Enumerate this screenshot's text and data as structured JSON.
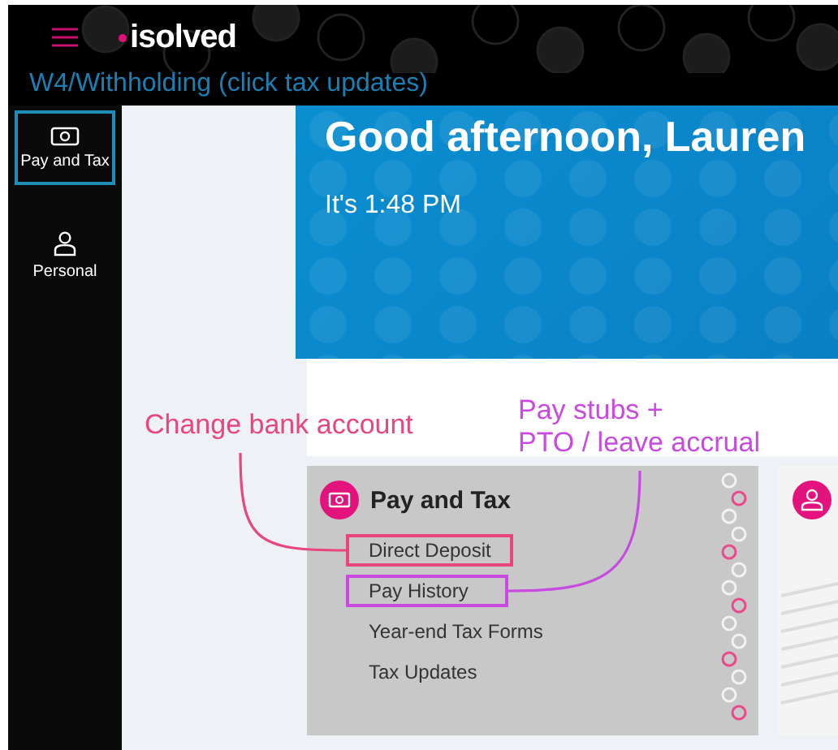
{
  "header": {
    "logo": "isolved",
    "note": "W4/Withholding (click tax updates)"
  },
  "sidebar": {
    "items": [
      {
        "kind": "pay",
        "label": "Pay and Tax",
        "selected": true
      },
      {
        "kind": "person",
        "label": "Personal",
        "selected": false
      }
    ]
  },
  "hero": {
    "greeting": "Good afternoon, Lauren",
    "time": "It's 1:48 PM"
  },
  "annotations": [
    {
      "lines": [
        "Change bank account"
      ],
      "color": "#e8467c"
    },
    {
      "lines": [
        "Pay stubs +",
        "PTO / leave accrual"
      ],
      "color": "#c84ae0"
    }
  ],
  "cards": [
    {
      "kind": "pay",
      "title": "Pay and Tax",
      "links": [
        {
          "label": "Direct Deposit",
          "color": "#e8467c"
        },
        {
          "label": "Pay History",
          "color": "#c84ae0"
        },
        {
          "label": "Year-end Tax Forms"
        },
        {
          "label": "Tax Updates"
        }
      ]
    },
    {
      "kind": "person"
    }
  ]
}
